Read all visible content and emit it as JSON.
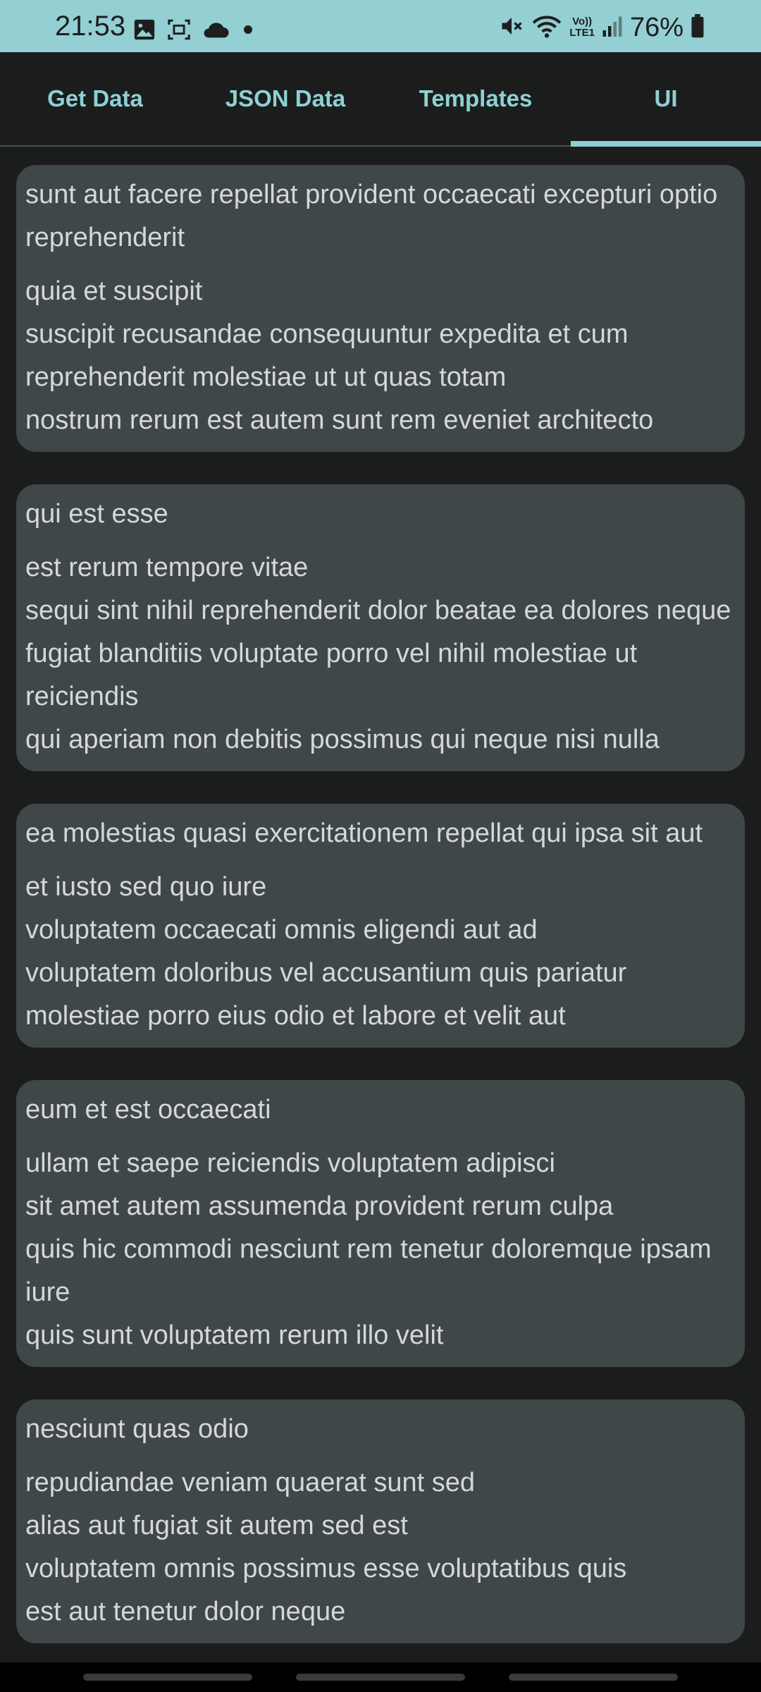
{
  "status_bar": {
    "time": "21:53",
    "battery": "76%",
    "icons_left": [
      "image-icon",
      "screenshot-icon",
      "cloud-icon",
      "dot-icon"
    ],
    "icons_right": [
      "mute-icon",
      "wifi-icon",
      "volte-icon",
      "signal-icon",
      "battery-icon"
    ],
    "volte_label_top": "Vo))",
    "volte_label_bottom": "LTE1"
  },
  "tabs": [
    {
      "label": "Get Data"
    },
    {
      "label": "JSON Data"
    },
    {
      "label": "Templates"
    },
    {
      "label": "UI",
      "active": true
    }
  ],
  "posts": [
    {
      "title": "sunt aut facere repellat provident occaecati excepturi optio reprehenderit",
      "body": "quia et suscipit\nsuscipit recusandae consequuntur expedita et cum\nreprehenderit molestiae ut ut quas totam\nnostrum rerum est autem sunt rem eveniet architecto"
    },
    {
      "title": "qui est esse",
      "body": "est rerum tempore vitae\nsequi sint nihil reprehenderit dolor beatae ea dolores neque\nfugiat blanditiis voluptate porro vel nihil molestiae ut reiciendis\nqui aperiam non debitis possimus qui neque nisi nulla"
    },
    {
      "title": "ea molestias quasi exercitationem repellat qui ipsa sit aut",
      "body": "et iusto sed quo iure\nvoluptatem occaecati omnis eligendi aut ad\nvoluptatem doloribus vel accusantium quis pariatur\nmolestiae porro eius odio et labore et velit aut"
    },
    {
      "title": "eum et est occaecati",
      "body": "ullam et saepe reiciendis voluptatem adipisci\nsit amet autem assumenda provident rerum culpa\nquis hic commodi nesciunt rem tenetur doloremque ipsam iure\nquis sunt voluptatem rerum illo velit"
    },
    {
      "title": "nesciunt quas odio",
      "body": "repudiandae veniam quaerat sunt sed\nalias aut fugiat sit autem sed est\nvoluptatem omnis possimus esse voluptatibus quis\nest aut tenetur dolor neque"
    }
  ],
  "colors": {
    "status_bar": "#93cfd3",
    "background": "#1b1d1d",
    "card": "#3f4748",
    "accent": "#8fd0d6",
    "text": "#d5d8d8"
  }
}
